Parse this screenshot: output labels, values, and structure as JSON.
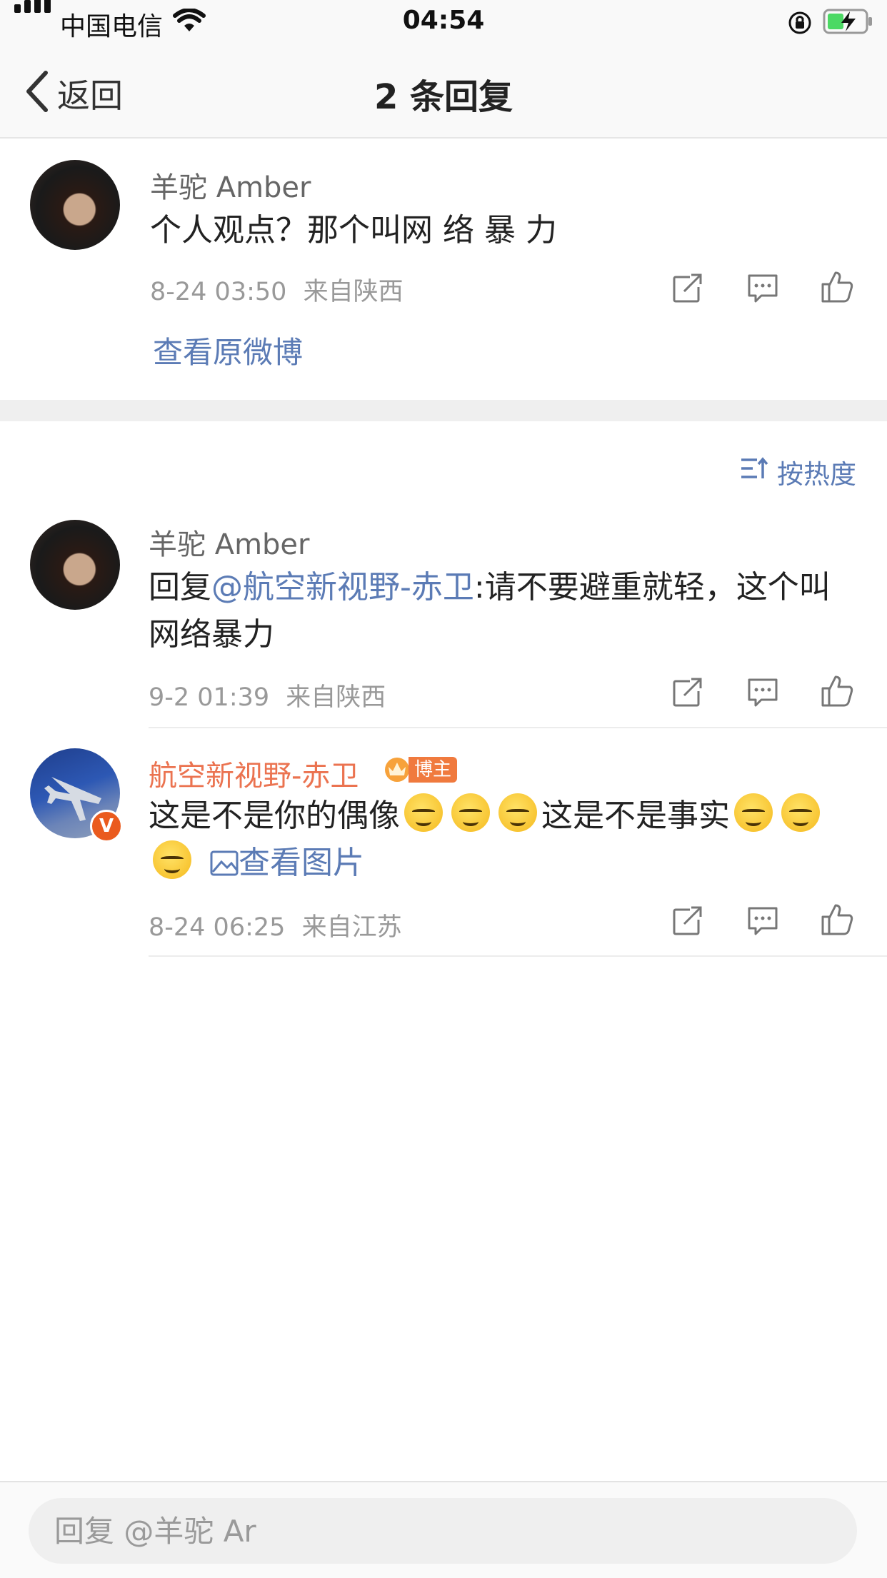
{
  "status_bar": {
    "carrier": "中国电信",
    "time": "04:54"
  },
  "nav": {
    "back_label": "返回",
    "title": "2 条回复"
  },
  "main_comment": {
    "username": "羊驼 Amber",
    "text": "个人观点？那个叫网 络 暴 力",
    "date": "8-24 03:50",
    "location": "来自陕西",
    "view_original": "查看原微博"
  },
  "sort": {
    "label": "按热度"
  },
  "replies": [
    {
      "username": "羊驼 Amber",
      "prefix": "回复",
      "mention": "@航空新视野-赤卫",
      "text": ":请不要避重就轻，这个叫网络暴力",
      "date": "9-2 01:39",
      "location": "来自陕西"
    },
    {
      "username": "航空新视野-赤卫",
      "badge": "博主",
      "text_part1": "这是不是你的偶像",
      "text_part2": "这是不是事实",
      "view_image": "查看图片",
      "date": "8-24 06:25",
      "location": "来自江苏"
    }
  ],
  "reply_input": {
    "placeholder": "回复 @羊驼 Ar"
  },
  "colors": {
    "link": "#5b7bb5",
    "author_name": "#eb7350",
    "badge": "#f07a3e",
    "verified": "#ea5b1e"
  },
  "icons": [
    "share-icon",
    "comment-icon",
    "like-icon",
    "sort-icon",
    "image-icon",
    "crown-icon"
  ]
}
